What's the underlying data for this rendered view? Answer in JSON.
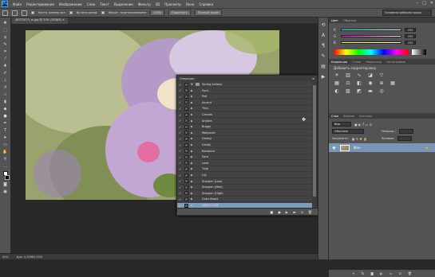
{
  "menubar": {
    "logo": "Ps",
    "items": [
      "Файл",
      "Редактирование",
      "Изображение",
      "Слои",
      "Текст",
      "Выделение",
      "Фильтр",
      "3D",
      "Просмотр",
      "Окно",
      "Справка"
    ],
    "window_controls": [
      "–",
      "□",
      "✕"
    ]
  },
  "options": {
    "resize_windows": "Кастр. размер окн",
    "all_windows": "Во всех окнах",
    "scrubby_zoom": "Масшт. перетаскиванием",
    "zoom_100": "100%",
    "fit_screen": "Подогнать",
    "fill_screen": "Полный экран",
    "workspace": "Основная рабочая среда"
  },
  "document": {
    "tab": "48372573_m.jpg @ 50% (RGB/8) ×"
  },
  "status": {
    "zoom": "50%",
    "doc_size": "Док: 5,92M/5,92M"
  },
  "actions_panel": {
    "title": "Операции",
    "items": [
      "Spring Actions",
      "Sync",
      "Pad",
      "Accord",
      "Tinly",
      "Canvas",
      "Andora",
      "Buggy",
      "Mailyuser",
      "Galaxy",
      "Candy",
      "Radiance",
      "Sara",
      "Lead",
      "Tulip",
      "Lily",
      "Sharpen (Low)",
      "Sharpen (Med)",
      "Sharpen (High)",
      "Color Boost",
      "LENS FLARE"
    ],
    "selected_index": 20,
    "footer_icons": [
      "■",
      "●",
      "▶",
      "▬",
      "⊡",
      "🗑"
    ]
  },
  "right": {
    "color_tabs": [
      "Цвет",
      "Образцы"
    ],
    "channels": [
      {
        "label": "R",
        "value": "255",
        "grad": "linear-gradient(90deg,#00ffff,#ffffff)"
      },
      {
        "label": "G",
        "value": "255",
        "grad": "linear-gradient(90deg,#ff00ff,#ffffff)"
      },
      {
        "label": "B",
        "value": "255",
        "grad": "linear-gradient(90deg,#ffff00,#ffffff)"
      }
    ],
    "adjust_tabs": [
      "Коррекция",
      "Стили",
      "Навигатор",
      "Гистограмма"
    ],
    "adjust_title": "Добавить корректировку",
    "layers_tabs": [
      "Слои",
      "Каналы",
      "Контуры"
    ],
    "layer_kind": "Вид",
    "blend_mode": "Обычные",
    "opacity_label": "Непрозр.:",
    "lock_label": "Закрепить:",
    "fill_label": "Заливка:",
    "layer_name": "Фон"
  }
}
